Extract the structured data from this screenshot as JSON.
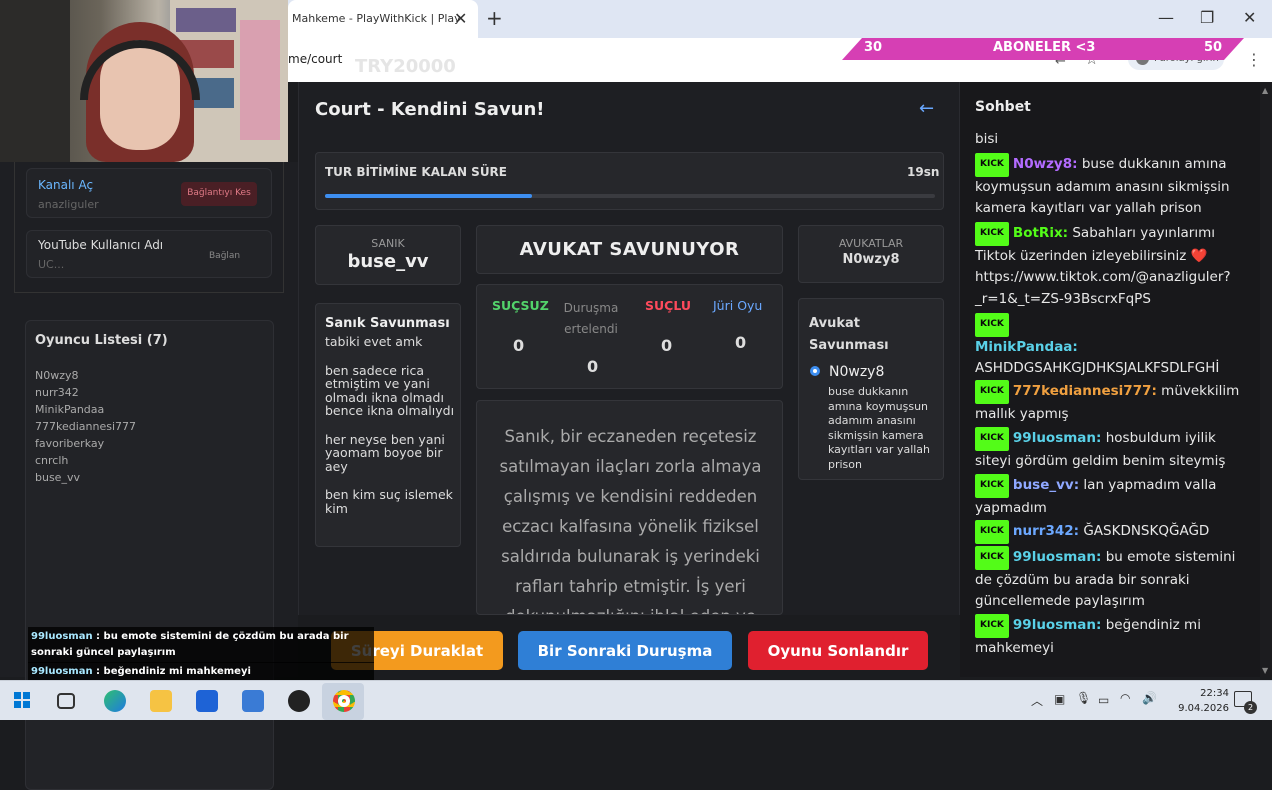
{
  "browser": {
    "tab_title": "Mahkeme - PlayWithKick | Play",
    "tab_close": "✕",
    "new_tab": "+",
    "url": "me/court",
    "url_ghost": "TRY20000",
    "profile_label": "Parolayı girin",
    "win_min": "—",
    "win_restore": "❐",
    "win_close": "✕"
  },
  "sub_goal": {
    "left": "30",
    "label": "ABONELER <3",
    "right": "50"
  },
  "left_panel": {
    "channel_label": "Kanalı Aç",
    "channel_value": "anazliguler",
    "disconnect": "Bağlantıyı Kes",
    "youtube_label": "YouTube Kullanıcı Adı",
    "youtube_value": "UC...",
    "connect": "Bağlan",
    "players_title": "Oyuncu Listesi (7)",
    "players": [
      "N0wzy8",
      "nurr342",
      "MinikPandaa",
      "777kediannesi777",
      "favoriberkay",
      "cnrclh",
      "buse_vv"
    ]
  },
  "court": {
    "title": "Court - Kendini Savun!",
    "back_arrow": "←",
    "timer_label": "TUR BİTİMİNE KALAN SÜRE",
    "timer_value": "19sn",
    "timer_progress": 0.34,
    "defendant_label": "SANIK",
    "defendant_name": "buse_vv",
    "status_title": "AVUKAT SAVUNUYOR",
    "lawyers_label": "AVUKATLAR",
    "lawyers_name": "N0wzy8",
    "defense_title": "Sanık Savunması",
    "defense_lines": [
      "tabiki evet amk",
      "ben sadece rica etmiştim ve yani olmadı ikna olmadı bence ikna olmalıydı",
      "her neyse ben yani yaomam boyoe bir aey",
      "ben kim suç islemek kim"
    ],
    "votes": {
      "not_guilty_label": "SUÇSUZ",
      "not_guilty": "0",
      "postponed_label": "Duruşma ertelendi",
      "postponed": "0",
      "guilty_label": "SUÇLU",
      "guilty": "0",
      "jury_label": "Jüri Oyu",
      "jury": "0"
    },
    "case_text": "Sanık, bir eczaneden reçetesiz satılmayan ilaçları zorla almaya çalışmış ve kendisini reddeden eczacı kalfasına yönelik fiziksel saldırıda bulunarak iş yerindeki rafları tahrip etmiştir. İş yeri dokunulmazlığını ihlal eden ve",
    "lawyer_defense_title": "Avukat Savunması",
    "lawyer_defense_name": "N0wzy8",
    "lawyer_defense_text": "buse dukkanın amına koymuşsun adamım anasını sikmişsin kamera kayıtları var yallah prison"
  },
  "buttons": {
    "pause": "Süreyi Duraklat",
    "next": "Bir Sonraki Duruşma",
    "end": "Oyunu Sonlandır"
  },
  "chat": {
    "title": "Sohbet",
    "badge": "KICK",
    "first": "bisi",
    "messages": [
      {
        "user": "N0wzy8:",
        "color": "#b36bff",
        "text": " buse dukkanın amına koymuşsun adamım anasını sikmişsin kamera kayıtları var yallah prison"
      },
      {
        "user": "BotRix:",
        "color": "#53fc18",
        "text": " Sabahları yayınlarımı Tiktok üzerinden izleyebilirsiniz ❤️ https://www.tiktok.com/@anazliguler?_r=1&_t=ZS-93BscrxFqPS"
      },
      {
        "user": "MinikPandaa:",
        "color": "#5ad1e8",
        "text": " ASHDDGSAHKGJDHKSJALKFSDLFGHİ"
      },
      {
        "user": "777kediannesi777:",
        "color": "#f0a040",
        "text": " müvekkilim mallık yapmış"
      },
      {
        "user": "99luosman:",
        "color": "#5ad1e8",
        "text": " hosbuldum iyilik siteyi gördüm geldim benim siteymiş"
      },
      {
        "user": "buse_vv:",
        "color": "#8fa8ff",
        "text": " lan yapmadım valla yapmadım"
      },
      {
        "user": "nurr342:",
        "color": "#6ca8ff",
        "text": " ĞASKDNSKQĞAĞD"
      },
      {
        "user": "99luosman:",
        "color": "#5ad1e8",
        "text": " bu emote sistemini de çözdüm bu arada bir sonraki güncellemede paylaşırım"
      },
      {
        "user": "99luosman:",
        "color": "#5ad1e8",
        "text": " beğendiniz mi mahkemeyi"
      }
    ]
  },
  "overlay_chat": [
    {
      "user": "99luosman",
      "text": " : bu emote sistemini de çözdüm bu arada bir sonraki güncel paylaşırım"
    },
    {
      "user": "99luosman",
      "text": " : beğendiniz mi mahkemeyi"
    }
  ],
  "taskbar": {
    "time": "22:34",
    "date": "9.04.2026",
    "notif_count": "2"
  }
}
